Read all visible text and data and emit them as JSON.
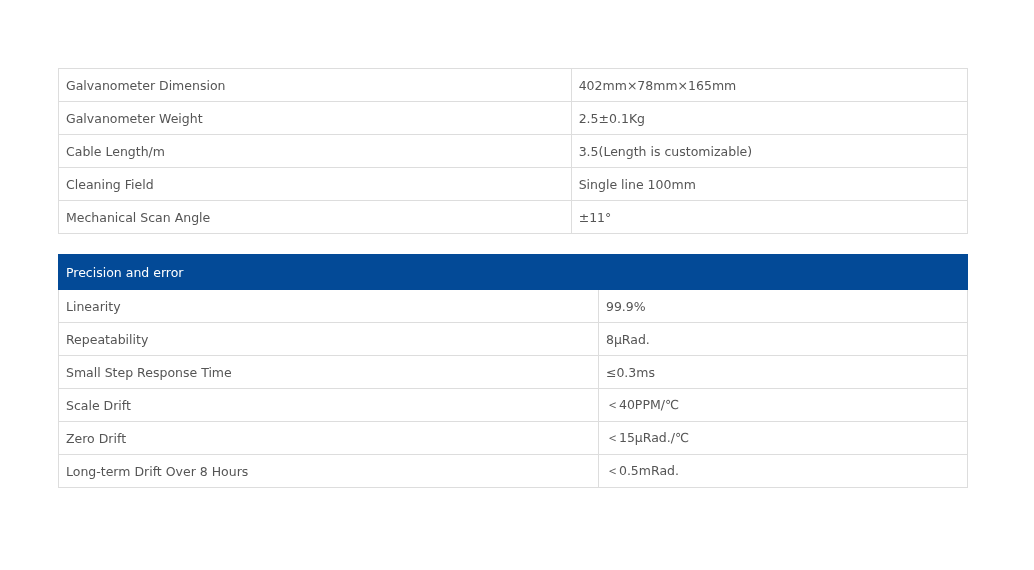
{
  "tables": [
    {
      "rows": [
        {
          "label": "Galvanometer Dimension",
          "value": "402mm×78mm×165mm"
        },
        {
          "label": "Galvanometer Weight",
          "value": "2.5±0.1Kg"
        },
        {
          "label": "Cable Length/m",
          "value": "3.5(Length is customizable)"
        },
        {
          "label": "Cleaning Field",
          "value": "Single line 100mm"
        },
        {
          "label": "Mechanical Scan Angle",
          "value": "±11°"
        }
      ]
    },
    {
      "title": "Precision and error",
      "rows": [
        {
          "label": "Linearity",
          "value": "99.9%"
        },
        {
          "label": "Repeatability",
          "value": "8μRad."
        },
        {
          "label": "Small Step Response Time",
          "value": "≤0.3ms"
        },
        {
          "label": "Scale Drift",
          "value": "＜40PPM/℃"
        },
        {
          "label": "Zero Drift",
          "value": "＜15μRad./℃"
        },
        {
          "label": "Long-term Drift Over 8 Hours",
          "value": "＜0.5mRad."
        }
      ]
    }
  ]
}
